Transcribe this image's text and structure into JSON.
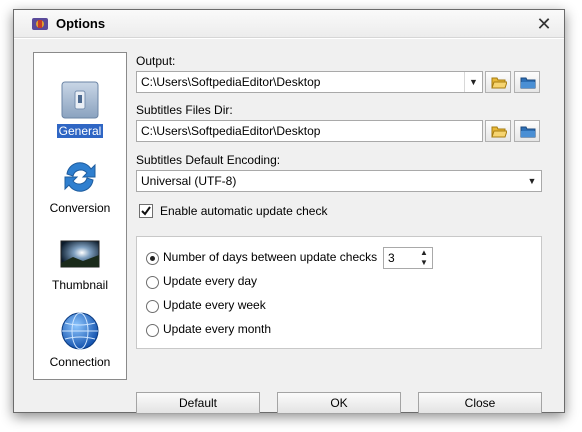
{
  "window": {
    "title": "Options",
    "close_glyph": "✕"
  },
  "nav": {
    "items": [
      {
        "label": "General",
        "icon": "switch-icon",
        "selected": true
      },
      {
        "label": "Conversion",
        "icon": "refresh-arrows-icon"
      },
      {
        "label": "Thumbnail",
        "icon": "image-thumbnail-icon"
      },
      {
        "label": "Connection",
        "icon": "globe-icon"
      }
    ]
  },
  "general": {
    "output_label": "Output:",
    "output_value": "C:\\Users\\SoftpediaEditor\\Desktop",
    "subs_dir_label": "Subtitles Files Dir:",
    "subs_dir_value": "C:\\Users\\SoftpediaEditor\\Desktop",
    "encoding_label": "Subtitles Default Encoding:",
    "encoding_value": "Universal (UTF-8)",
    "update_check_label": "Enable automatic update check",
    "update_check_checked": true,
    "update_options": [
      {
        "label": "Number of days between update checks",
        "selected": true
      },
      {
        "label": "Update every day",
        "selected": false
      },
      {
        "label": "Update every week",
        "selected": false
      },
      {
        "label": "Update every month",
        "selected": false
      }
    ],
    "days_value": "3"
  },
  "footer": {
    "default_label": "Default",
    "ok_label": "OK",
    "close_label": "Close"
  },
  "colors": {
    "selection": "#2f66c4",
    "folder": "#e8b838",
    "blue_folder": "#2d6fb5"
  }
}
